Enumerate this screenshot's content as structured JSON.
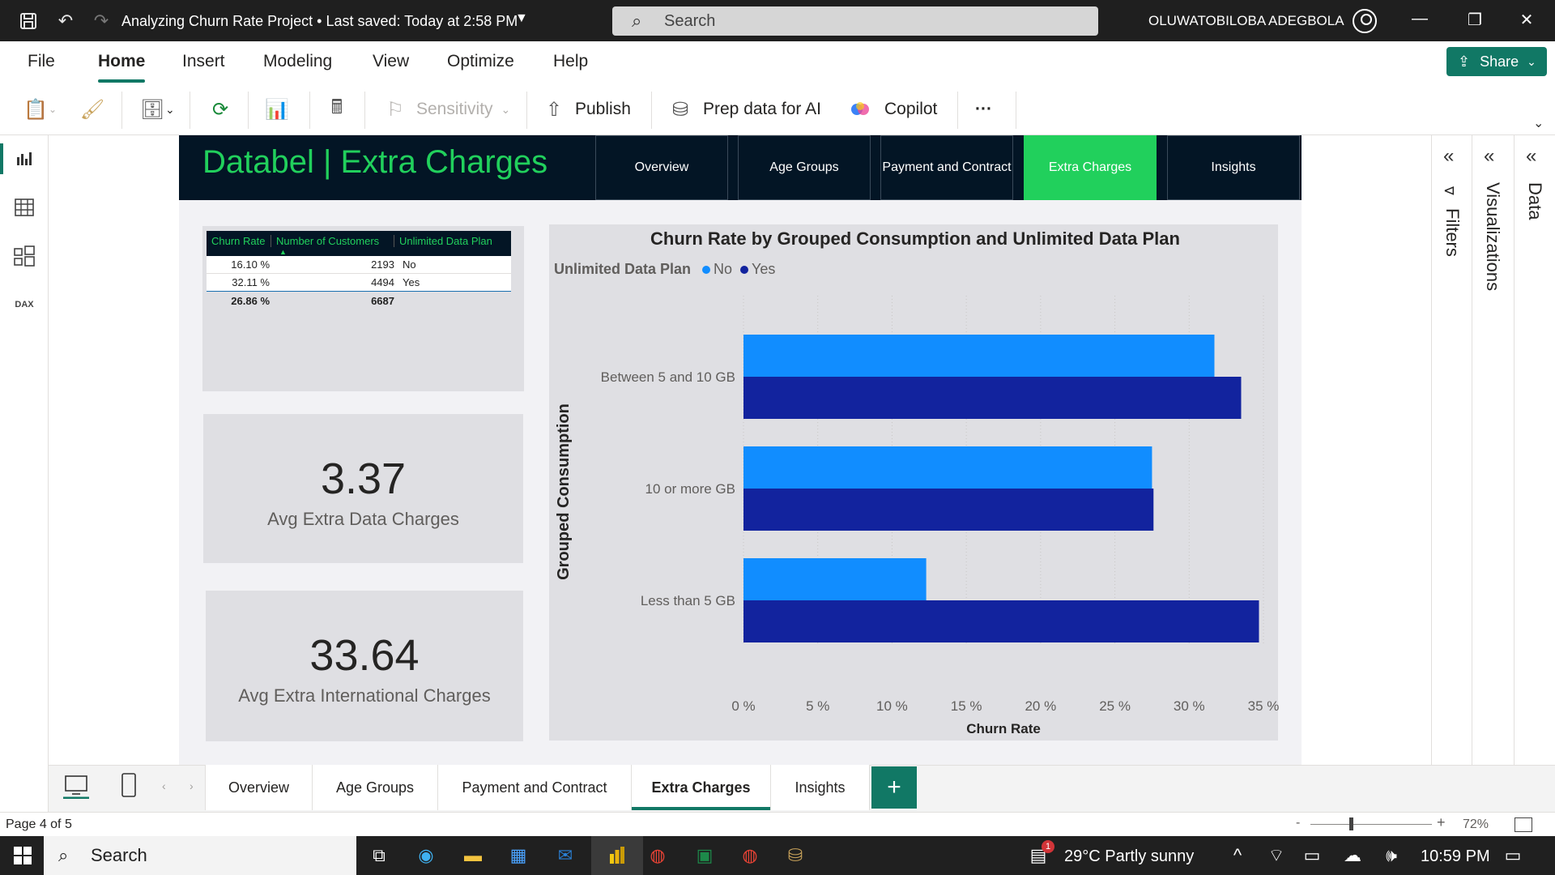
{
  "app": {
    "title": "Analyzing Churn Rate Project",
    "saved": "Last saved: Today at 2:58 PM",
    "search_placeholder": "Search",
    "user": "OLUWATOBILOBA ADEGBOLA"
  },
  "ribbon_tabs": [
    "File",
    "Home",
    "Insert",
    "Modeling",
    "View",
    "Optimize",
    "Help"
  ],
  "share_label": "Share",
  "toolbar": {
    "sensitivity": "Sensitivity",
    "publish": "Publish",
    "prep_ai": "Prep data for AI",
    "copilot": "Copilot",
    "more": "···"
  },
  "report": {
    "title": "Databel | Extra Charges",
    "nav": [
      "Overview",
      "Age Groups",
      "Payment and Contract",
      "Extra Charges",
      "Insights"
    ],
    "table": {
      "headers": [
        "Churn Rate",
        "Number of Customers",
        "Unlimited Data Plan"
      ],
      "rows": [
        [
          "16.10 %",
          "2193",
          "No"
        ],
        [
          "32.11 %",
          "4494",
          "Yes"
        ]
      ],
      "total": [
        "26.86 %",
        "6687",
        ""
      ]
    },
    "kpis": [
      {
        "value": "3.37",
        "label": "Avg Extra Data Charges"
      },
      {
        "value": "33.64",
        "label": "Avg Extra International Charges"
      }
    ]
  },
  "chart_data": {
    "type": "bar",
    "orientation": "horizontal",
    "title": "Churn Rate by Grouped Consumption and Unlimited Data Plan",
    "legend_title": "Unlimited Data Plan",
    "xlabel": "Churn Rate",
    "ylabel": "Grouped Consumption",
    "categories": [
      "Between 5 and 10 GB",
      "10 or more GB",
      "Less than 5 GB"
    ],
    "series": [
      {
        "name": "No",
        "color": "#118dff",
        "values": [
          31.7,
          27.5,
          12.3
        ]
      },
      {
        "name": "Yes",
        "color": "#12239e",
        "values": [
          33.5,
          27.6,
          34.7
        ]
      }
    ],
    "xlim": [
      0,
      35
    ],
    "xticks": [
      "0 %",
      "5 %",
      "10 %",
      "15 %",
      "20 %",
      "25 %",
      "30 %",
      "35 %"
    ],
    "grid": true,
    "legend_position": "top-left"
  },
  "panes": {
    "filters": "Filters",
    "visualizations": "Visualizations",
    "data": "Data"
  },
  "page_tabs": [
    "Overview",
    "Age Groups",
    "Payment and Contract",
    "Extra Charges",
    "Insights"
  ],
  "status": {
    "page": "Page 4 of 5",
    "zoom": "72%"
  },
  "taskbar": {
    "search": "Search",
    "weather": "29°C  Partly sunny",
    "time": "10:59 PM",
    "notif_count": "1"
  }
}
